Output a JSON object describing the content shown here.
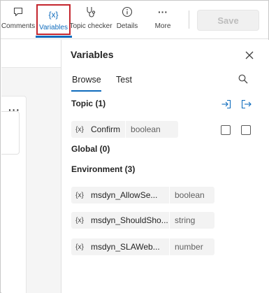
{
  "toolbar": {
    "items": [
      {
        "label": "Comments",
        "icon": "comment-icon"
      },
      {
        "label": "Variables",
        "icon": "variables-icon",
        "glyph": "{x}"
      },
      {
        "label": "Topic checker",
        "icon": "stethoscope-icon"
      },
      {
        "label": "Details",
        "icon": "info-icon"
      },
      {
        "label": "More",
        "icon": "more-icon",
        "glyph": "···"
      }
    ],
    "save_label": "Save"
  },
  "canvas": {
    "more_glyph": "···"
  },
  "panel": {
    "title": "Variables",
    "tabs": [
      {
        "label": "Browse",
        "selected": true
      },
      {
        "label": "Test",
        "selected": false
      }
    ],
    "sections": {
      "topic": "Topic (1)",
      "global": "Global (0)",
      "environment": "Environment (3)"
    },
    "topic_variables": [
      {
        "glyph": "{x}",
        "name": "Confirm",
        "type": "boolean",
        "checkbox1": false,
        "checkbox2": false
      }
    ],
    "environment_variables": [
      {
        "glyph": "{x}",
        "name": "msdyn_AllowSe...",
        "type": "boolean"
      },
      {
        "glyph": "{x}",
        "name": "msdyn_ShouldSho...",
        "type": "string"
      },
      {
        "glyph": "{x}",
        "name": "msdyn_SLAWeb...",
        "type": "number"
      }
    ]
  },
  "colors": {
    "accent": "#0f6cbd",
    "highlight_border": "#c4262e",
    "chip_bg": "#f3f3f3"
  }
}
